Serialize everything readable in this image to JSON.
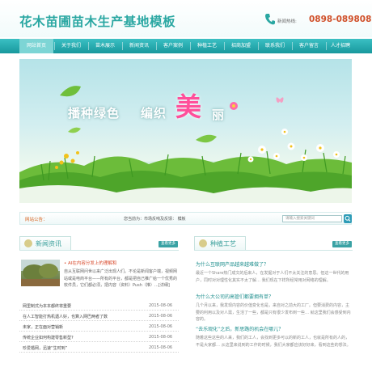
{
  "site": {
    "logo": "花木苗圃苗木生产基地模板",
    "hotline_label": "新闻热线:",
    "hotline_number": "0898-08980898"
  },
  "nav": {
    "items": [
      {
        "label": "网站首页",
        "active": true
      },
      {
        "label": "关于我们",
        "active": false
      },
      {
        "label": "苗木展示",
        "active": false
      },
      {
        "label": "新闻资讯",
        "active": false
      },
      {
        "label": "客户案例",
        "active": false
      },
      {
        "label": "种植工艺",
        "active": false
      },
      {
        "label": "招商加盟",
        "active": false
      },
      {
        "label": "联系我们",
        "active": false
      },
      {
        "label": "客户留言",
        "active": false
      },
      {
        "label": "人才招聘",
        "active": false
      }
    ]
  },
  "banner": {
    "text1": "播种绿色",
    "text2": "编织",
    "text3": "美",
    "text4": "丽"
  },
  "location": {
    "label": "网站公告：",
    "path": "您当前为：市场反响及反馈：   模板",
    "search_placeholder": "请输入搜索关键词"
  },
  "news": {
    "title": "新闻资讯",
    "more": "查看更多",
    "feature": {
      "title": "• AI在内容分发上的理解和",
      "desc": "自从互联网问世以来广泛出现人们。不论是新闻客户端，视频网站或是电商平台——所有的平台，都是把自己推广给一个优秀的软件员，它们都必须，把内容（资料）Push（推）…[详细]"
    },
    "items": [
      {
        "title": "网里制式为本本都终将重要",
        "date": "2015-08-06"
      },
      {
        "title": "在人工智能打热机遇人好，也算入网巴两者了数",
        "date": "2015-08-06"
      },
      {
        "title": "未家，正在面对营销新",
        "date": "2015-08-06"
      },
      {
        "title": "传统企业如何构建零售新型?",
        "date": "2015-08-06"
      },
      {
        "title": "珍爱婚网，迅速“生时到”",
        "date": "2015-08-06"
      }
    ]
  },
  "craft": {
    "title": "种植工艺",
    "more": "查看更多",
    "items": [
      {
        "title": "为什么互联网产品越来越难做了？",
        "desc": "最近一个Share热门成文的后来人，在发掘对于人们不太关注的意思。但这一世代的用户，同时对对理性化其实不太了解…  我们现在下样所经常用对网络的理解。"
      },
      {
        "title": "为什么大公司的高管们都要拥有单？",
        "desc": "几个月以来，我发现内容的价值变化也是，来自对之前大的工厂。但要消费的内容，主要的利用以及对人需，生活了一些，都是只有很少发布到一些…  就这里我们会感受到内容的。"
      },
      {
        "title": "“去乐观化”之后，新思路的机会在哪儿？",
        "desc": "随着这些这些的人来，我们的工人，会找到更多可以的新的工人，也就是所有的人的，不是大家都…  从这里来说到的工作的时候，我们大家都应该好好来，看到这些的想法。"
      }
    ]
  },
  "colors": {
    "brand": "#2aa7a2",
    "nav": "#1fa4a8",
    "accent_red": "#d84a2c",
    "banner_pink": "#ff4f9a"
  }
}
